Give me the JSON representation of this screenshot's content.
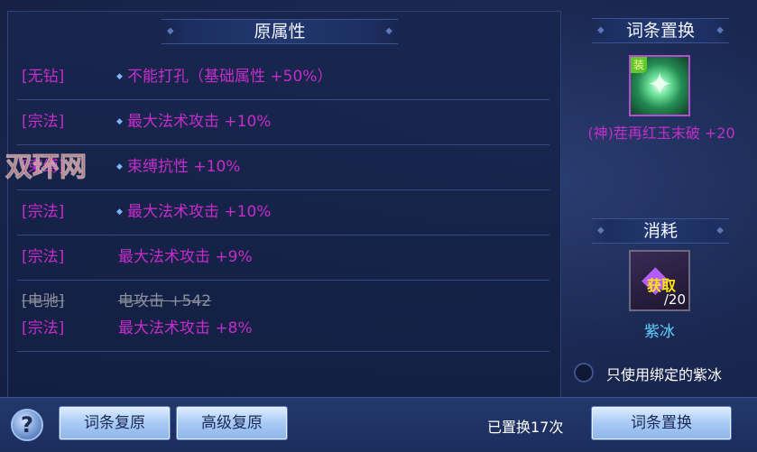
{
  "left_panel": {
    "title": "原属性",
    "rows": [
      {
        "lines": [
          {
            "tag": "[无钻]",
            "text": "不能打孔（基础属性 +50%）",
            "dot": true
          }
        ]
      },
      {
        "lines": [
          {
            "tag": "[宗法]",
            "text": "最大法术攻击 +10%",
            "dot": true
          }
        ]
      },
      {
        "lines": [
          {
            "tag": "[束缚]",
            "text": "束缚抗性 +10%",
            "dot": true
          }
        ]
      },
      {
        "lines": [
          {
            "tag": "[宗法]",
            "text": "最大法术攻击 +10%",
            "dot": true
          }
        ]
      },
      {
        "lines": [
          {
            "tag": "[宗法]",
            "text": "最大法术攻击 +9%",
            "dot": false
          }
        ]
      },
      {
        "lines": [
          {
            "tag": "[电驰]",
            "text": "电攻击 +542",
            "dot": false,
            "struck": true
          },
          {
            "tag": "[宗法]",
            "text": "最大法术攻击 +8%",
            "dot": false
          }
        ]
      }
    ]
  },
  "replace_section": {
    "title": "词条置换",
    "equipment": {
      "badge": "装",
      "name": "(神)茬再红玉末破 +20"
    }
  },
  "consume_section": {
    "title": "消耗",
    "material": {
      "label": "获取",
      "count": "/20",
      "name": "紫冰"
    }
  },
  "bound_only_option": {
    "label": "只使用绑定的紫冰",
    "checked": false
  },
  "bottom_bar": {
    "help_label": "?",
    "restore_button": "词条复原",
    "advanced_restore_button": "高级复原",
    "replaced_count": "已置换17次",
    "replace_button": "词条置换"
  },
  "watermark": "双环网",
  "colors": {
    "attribute_text": "#c42dc9",
    "struck_text": "#8b8f9e",
    "material_name": "#62d0ff",
    "accent_button": "#a9cbf6"
  }
}
